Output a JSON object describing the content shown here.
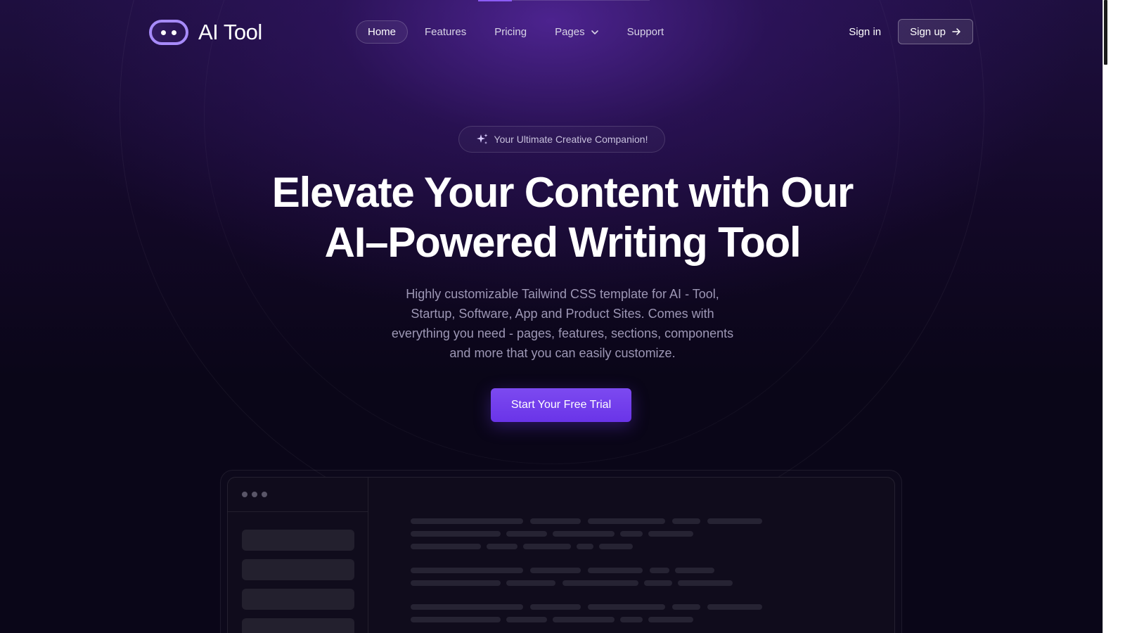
{
  "brand": {
    "name": "AI Tool",
    "logo_icon": "robot-face-icon"
  },
  "nav": {
    "items": [
      {
        "label": "Home",
        "active": true
      },
      {
        "label": "Features",
        "active": false
      },
      {
        "label": "Pricing",
        "active": false
      },
      {
        "label": "Pages",
        "active": false,
        "dropdown": true
      },
      {
        "label": "Support",
        "active": false
      }
    ]
  },
  "auth": {
    "sign_in": "Sign in",
    "sign_up": "Sign up"
  },
  "hero": {
    "badge": "Your Ultimate Creative Companion!",
    "title_line1": "Elevate Your Content with Our",
    "title_line2": "AI–Powered Writing Tool",
    "subtitle": "Highly customizable Tailwind CSS template for AI - Tool, Startup, Software, App and Product Sites. Comes with everything you need - pages, features, sections, components and more that you can easily customize.",
    "cta": "Start Your Free Trial"
  },
  "colors": {
    "accent": "#7c4af0",
    "background": "#0a0618",
    "logo_ring": "#a78bfa"
  }
}
